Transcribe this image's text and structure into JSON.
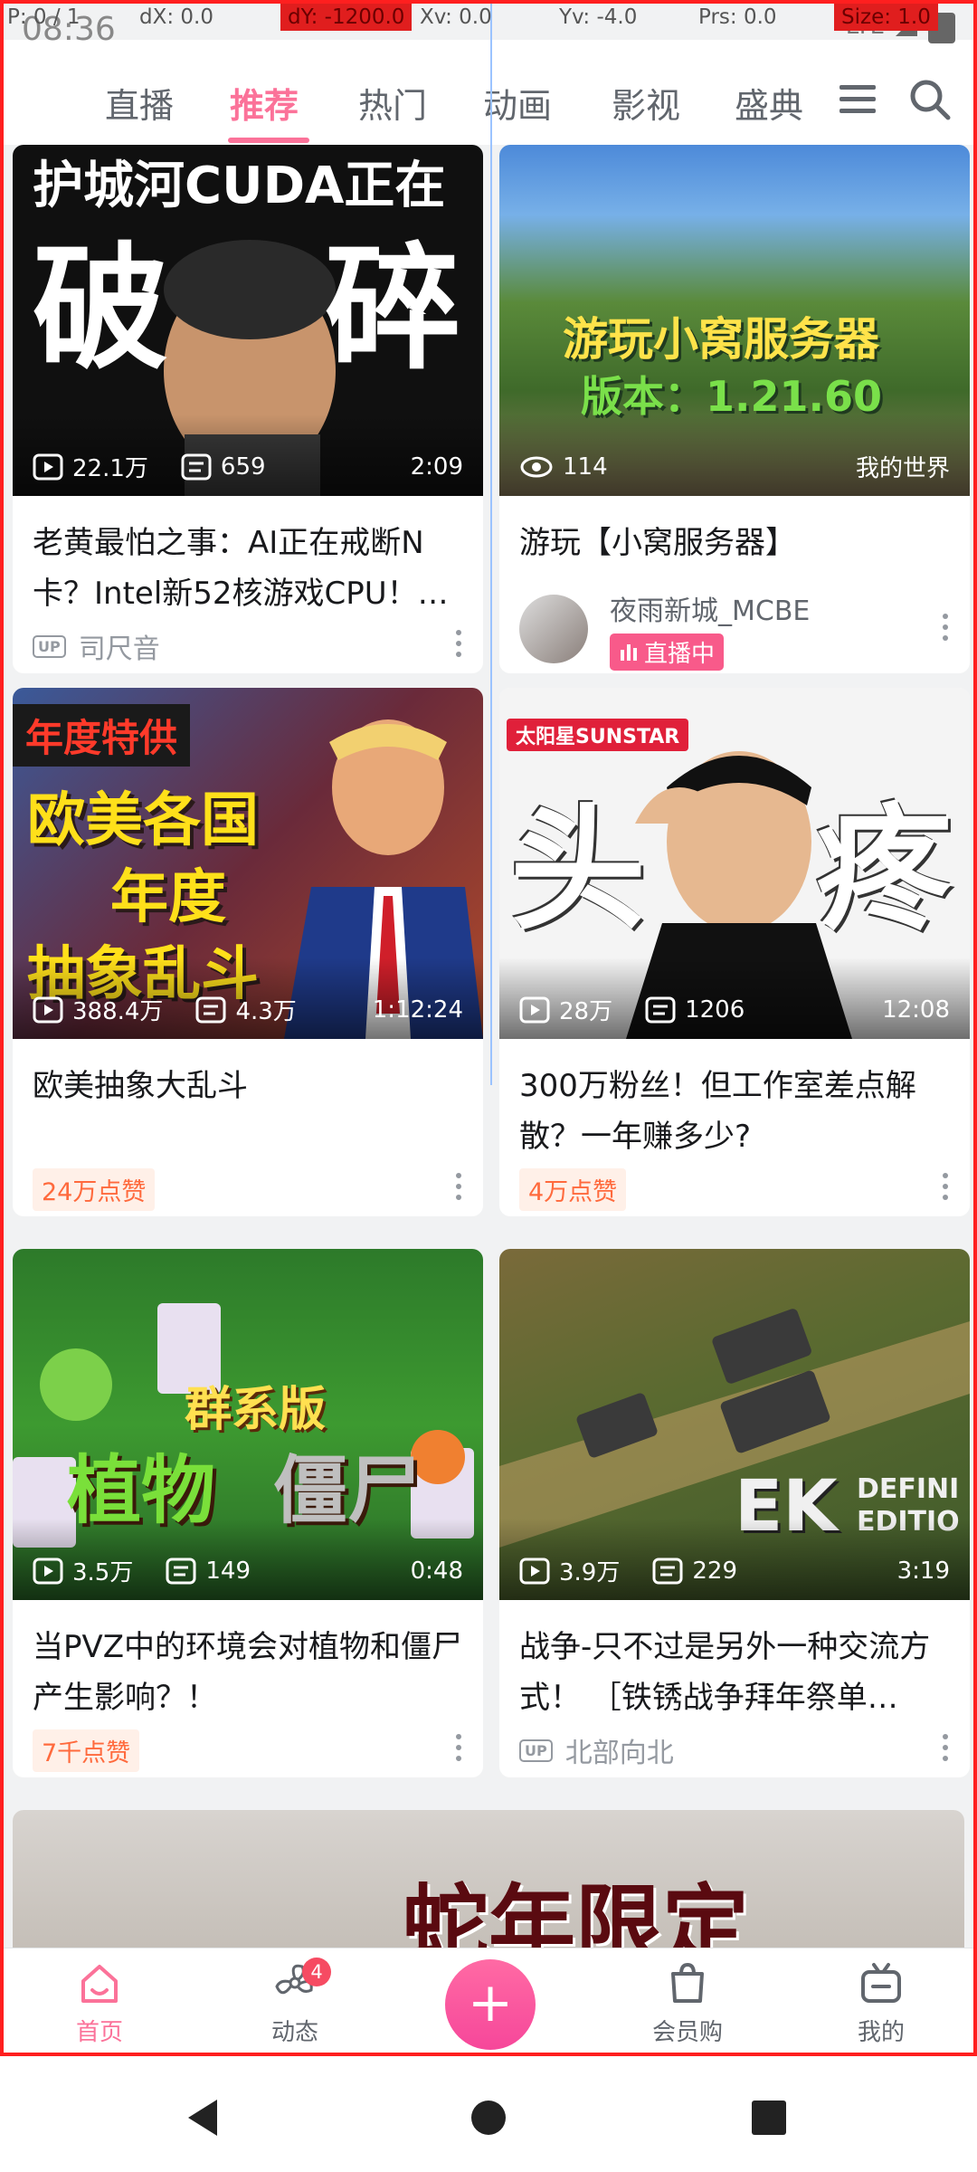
{
  "debug": {
    "p": "P: 0 / 1",
    "dx": "dX: 0.0",
    "dy": "dY: -1200.0",
    "xv": "Xv: 0.0",
    "yv": "Yv: -4.0",
    "prs": "Prs: 0.0",
    "size": "Size: 1.0"
  },
  "status": {
    "time": "08:36",
    "network": "LTE"
  },
  "tabs": [
    {
      "label": "直播"
    },
    {
      "label": "推荐"
    },
    {
      "label": "热门"
    },
    {
      "label": "动画"
    },
    {
      "label": "影视"
    },
    {
      "label": "盛典"
    }
  ],
  "cards": [
    {
      "cover_line1": "护城河CUDA正在",
      "cover_big_left": "破",
      "cover_big_right": "碎",
      "views": "22.1万",
      "danmaku": "659",
      "duration": "2:09",
      "title": "老黄最怕之事：AI正在戒断N卡？Intel新52核游戏CPU！…",
      "up_badge": "UP",
      "author": "司尺音"
    },
    {
      "cover_line1": "游玩小窝服务器",
      "cover_line2": "版本：1.21.60",
      "viewers": "114",
      "category": "我的世界",
      "title": "游玩【小窝服务器】",
      "author": "夜雨新城_MCBE",
      "live_label": "直播中"
    },
    {
      "cover_tag": "年度特供",
      "cover_line1": "欧美各国",
      "cover_line2": "年度",
      "cover_line3": "抽象乱斗",
      "views": "388.4万",
      "danmaku": "4.3万",
      "duration": "1:12:24",
      "title": "欧美抽象大乱斗",
      "likes": "24万点赞"
    },
    {
      "cover_brand": "太阳星SUNSTAR",
      "cover_big_left": "头",
      "cover_big_right": "疼",
      "views": "28万",
      "danmaku": "1206",
      "duration": "12:08",
      "title": "300万粉丝！但工作室差点解散？一年赚多少?",
      "likes": "4万点赞"
    },
    {
      "cover_line1": "群系版",
      "cover_line2": "植物",
      "cover_line3": "僵尸",
      "views": "3.5万",
      "danmaku": "149",
      "duration": "0:48",
      "title": "当PVZ中的环境会对植物和僵尸产生影响？！",
      "likes": "7千点赞"
    },
    {
      "cover_line1": "EK",
      "cover_line2": "DEFINI",
      "cover_line3": "EDITIO",
      "views": "3.9万",
      "danmaku": "229",
      "duration": "3:19",
      "title": "战争-只不过是另外一种交流方式！ ［铁锈战争拜年祭单…",
      "up_badge": "UP",
      "author": "北部向北"
    },
    {
      "cover_line1": "蛇年限定"
    }
  ],
  "bottom_nav": {
    "home": "首页",
    "dynamic": "动态",
    "dynamic_badge": "4",
    "plus": "+",
    "shop": "会员购",
    "mine": "我的"
  },
  "colors": {
    "accent": "#fb7299",
    "like": "#ff6a3d",
    "live": "#f85a8a"
  }
}
